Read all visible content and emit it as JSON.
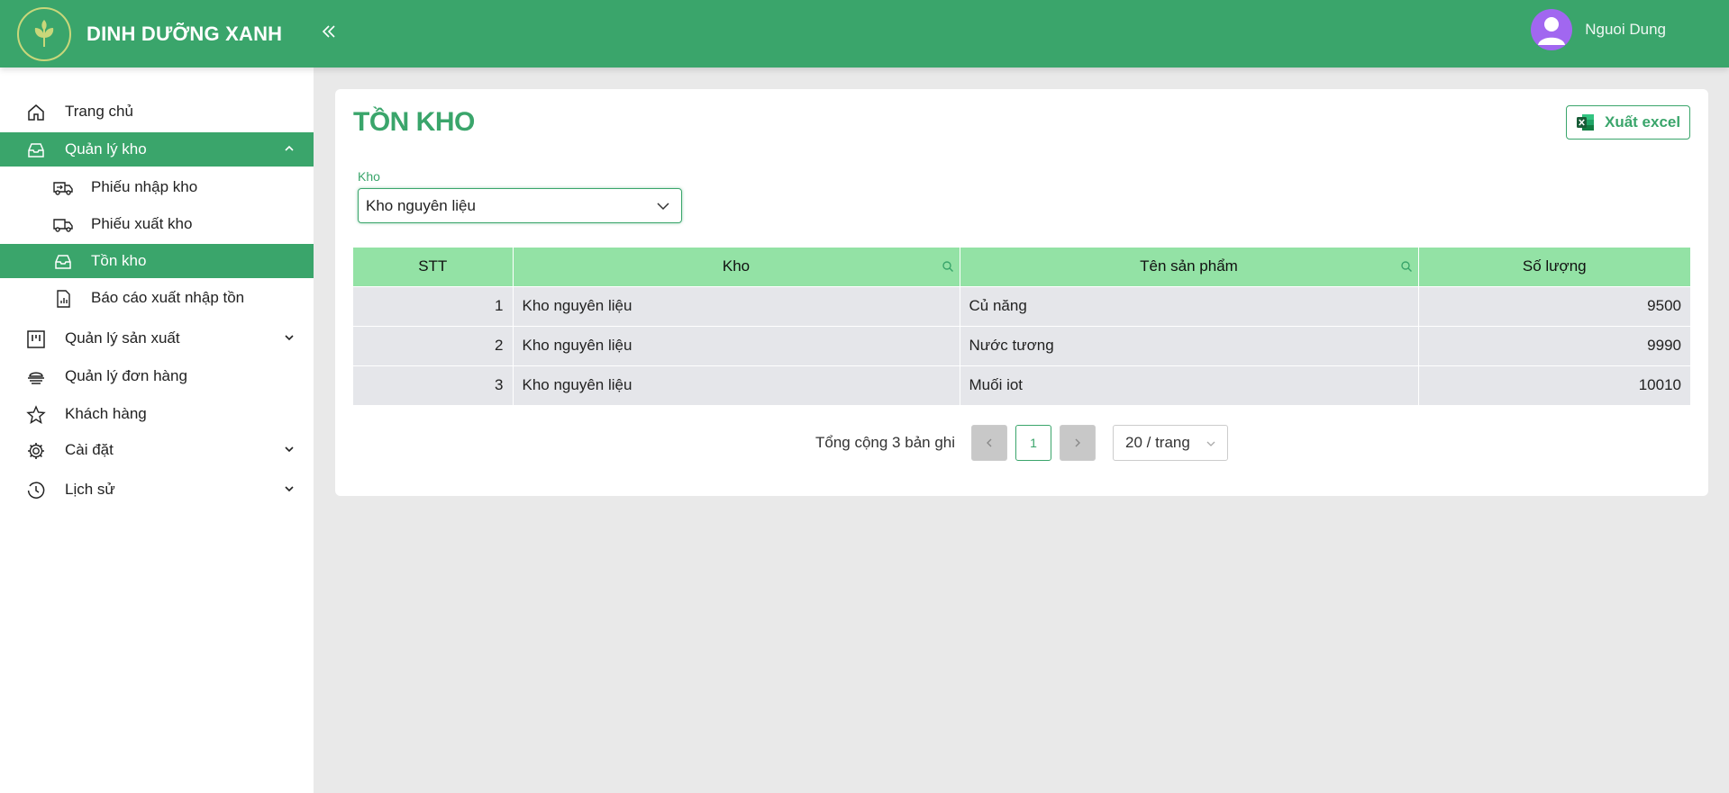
{
  "brand": {
    "name": "DINH DƯỠNG XANH"
  },
  "user": {
    "name": "Nguoi Dung"
  },
  "sidebar": {
    "items": [
      {
        "label": "Trang chủ",
        "icon": "home-icon"
      },
      {
        "label": "Quản lý kho",
        "icon": "inbox-icon",
        "expanded": true
      },
      {
        "label": "Phiếu nhập kho",
        "icon": "truck-in-icon"
      },
      {
        "label": "Phiếu xuất kho",
        "icon": "truck-out-icon"
      },
      {
        "label": "Tồn kho",
        "icon": "inbox-icon",
        "active": true
      },
      {
        "label": "Báo cáo xuất nhập tồn",
        "icon": "report-icon"
      },
      {
        "label": "Quản lý sản xuất",
        "icon": "factory-icon"
      },
      {
        "label": "Quản lý đơn hàng",
        "icon": "order-icon"
      },
      {
        "label": "Khách hàng",
        "icon": "star-icon"
      },
      {
        "label": "Cài đặt",
        "icon": "gear-icon"
      },
      {
        "label": "Lịch sử",
        "icon": "history-icon"
      }
    ]
  },
  "main": {
    "title": "TỒN KHO",
    "export_label": "Xuất excel",
    "filter": {
      "label": "Kho",
      "value": "Kho nguyên liệu"
    },
    "table": {
      "columns": [
        "STT",
        "Kho",
        "Tên sản phẩm",
        "Số lượng"
      ],
      "rows": [
        [
          "1",
          "Kho nguyên liệu",
          "Củ năng",
          "9500"
        ],
        [
          "2",
          "Kho nguyên liệu",
          "Nước tương",
          "9990"
        ],
        [
          "3",
          "Kho nguyên liệu",
          "Muối iot",
          "10010"
        ]
      ]
    },
    "pagination": {
      "total_text": "Tổng cộng 3 bản ghi",
      "current_page": "1",
      "page_size": "20 / trang"
    }
  },
  "colors": {
    "primary": "#3aa56b",
    "header_row": "#93e2a5",
    "row_bg": "#e5e6ea",
    "avatar": "#a167f0"
  }
}
